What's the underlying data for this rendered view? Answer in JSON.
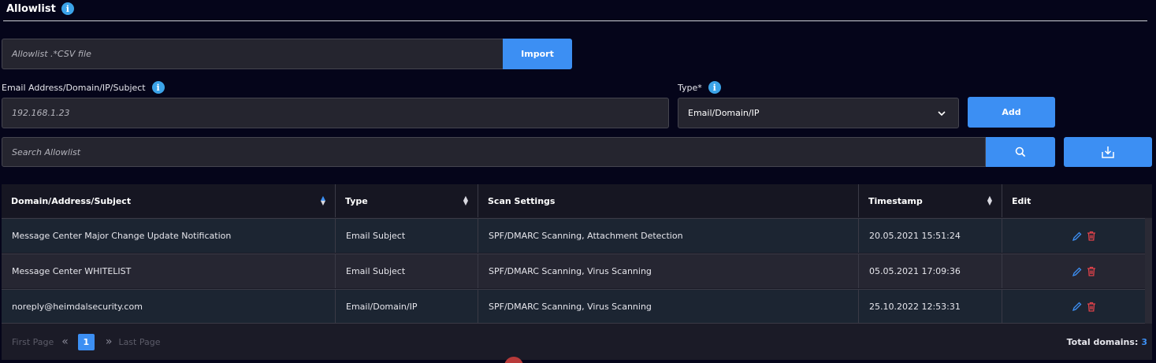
{
  "header": {
    "title": "Allowlist",
    "info_glyph": "i"
  },
  "csv_import": {
    "placeholder": "Allowlist .*CSV file",
    "button_label": "Import"
  },
  "entry": {
    "label": "Email Address/Domain/IP/Subject",
    "value": "192.168.1.23",
    "type_label": "Type*",
    "type_value": "Email/Domain/IP",
    "add_label": "Add"
  },
  "search": {
    "placeholder": "Search Allowlist"
  },
  "table": {
    "columns": [
      "Domain/Address/Subject",
      "Type",
      "Scan Settings",
      "Timestamp",
      "Edit"
    ],
    "rows": [
      {
        "subject": "Message Center Major Change Update Notification",
        "type": "Email Subject",
        "scan": "SPF/DMARC Scanning, Attachment Detection",
        "timestamp": "20.05.2021  15:51:24"
      },
      {
        "subject": "Message Center WHITELIST",
        "type": "Email Subject",
        "scan": "SPF/DMARC Scanning, Virus Scanning",
        "timestamp": "05.05.2021  17:09:36"
      },
      {
        "subject": "noreply@heimdalsecurity.com",
        "type": "Email/Domain/IP",
        "scan": "SPF/DMARC Scanning, Virus Scanning",
        "timestamp": "25.10.2022  12:53:31"
      }
    ]
  },
  "pagination": {
    "first": "First Page",
    "current": "1",
    "last": "Last Page",
    "total_label": "Total domains:",
    "total_count": "3"
  },
  "colors": {
    "accent": "#3c8ff3",
    "background": "#05051a",
    "danger": "#e0424a"
  },
  "icons": [
    "info-icon",
    "chevron-down-icon",
    "search-icon",
    "download-icon",
    "sort-icon",
    "edit-icon",
    "trash-icon",
    "double-chevron-left-icon",
    "double-chevron-right-icon"
  ]
}
